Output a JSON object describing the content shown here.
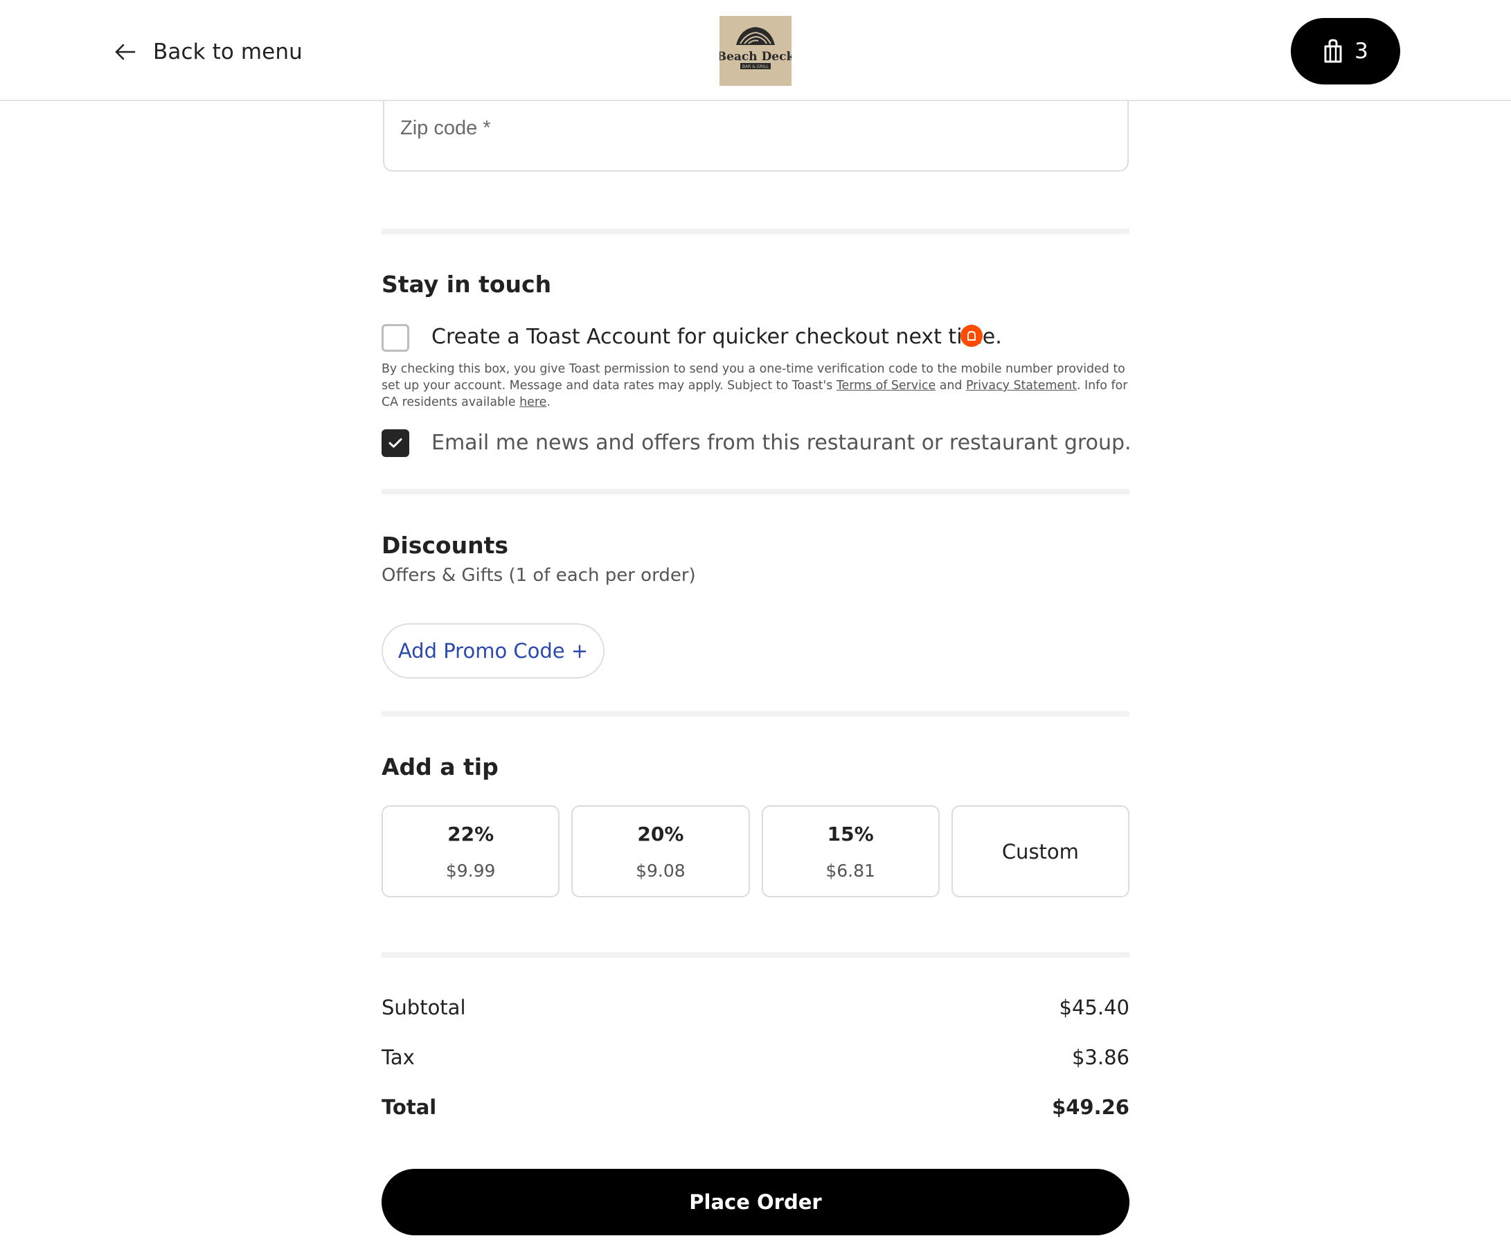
{
  "header": {
    "back_label": "Back to menu",
    "logo_text": "Beach Deck",
    "logo_subtext": "BAR & GRILL",
    "cart_count": "3"
  },
  "address": {
    "zip_placeholder": "Zip code *"
  },
  "stay_in_touch": {
    "title": "Stay in touch",
    "create_account_label": "Create a Toast Account for quicker checkout next time.",
    "create_account_checked": false,
    "disclaimer_part1": "By checking this box, you give Toast permission to send you a one-time verification code to the mobile number provided to set up your account. Message and data rates may apply. Subject to Toast's ",
    "terms_link": "Terms of Service",
    "and_text": " and ",
    "privacy_link": "Privacy Statement",
    "disclaimer_part2": ". Info for CA residents available ",
    "here_link": "here",
    "period": ".",
    "email_offers_label": "Email me news and offers from this restaurant or restaurant group.",
    "email_offers_checked": true
  },
  "discounts": {
    "title": "Discounts",
    "subtitle": "Offers & Gifts (1 of each per order)",
    "promo_button": "Add Promo Code +"
  },
  "tip": {
    "title": "Add a tip",
    "options": [
      {
        "percent": "22%",
        "amount": "$9.99"
      },
      {
        "percent": "20%",
        "amount": "$9.08"
      },
      {
        "percent": "15%",
        "amount": "$6.81"
      }
    ],
    "custom_label": "Custom"
  },
  "summary": {
    "subtotal_label": "Subtotal",
    "subtotal_value": "$45.40",
    "tax_label": "Tax",
    "tax_value": "$3.86",
    "total_label": "Total",
    "total_value": "$49.26"
  },
  "place_order_label": "Place Order",
  "colors": {
    "accent_link": "#2b49ad",
    "toast_orange": "#ff4c00",
    "primary_button": "#000000"
  }
}
